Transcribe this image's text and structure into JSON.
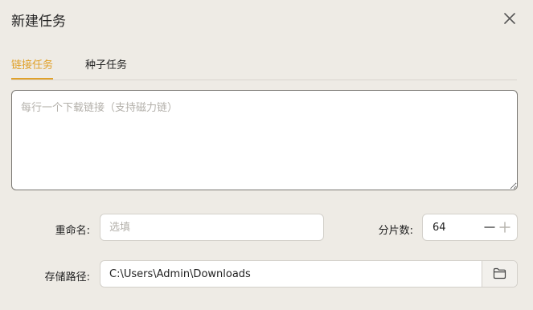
{
  "dialog": {
    "title": "新建任务"
  },
  "tabs": [
    {
      "label": "链接任务",
      "active": true
    },
    {
      "label": "种子任务",
      "active": false
    }
  ],
  "link_input": {
    "value": "",
    "placeholder": "每行一个下载链接（支持磁力链）"
  },
  "rename": {
    "label": "重命名:",
    "value": "",
    "placeholder": "选填"
  },
  "chunks": {
    "label": "分片数:",
    "value": "64"
  },
  "save_path": {
    "label": "存储路径:",
    "value": "C:\\Users\\Admin\\Downloads"
  },
  "icons": {
    "close": "close-icon",
    "minus": "minus-icon",
    "plus": "plus-icon",
    "folder": "folder-icon"
  },
  "colors": {
    "accent": "#E0A12A",
    "background": "#EEEBE5"
  }
}
